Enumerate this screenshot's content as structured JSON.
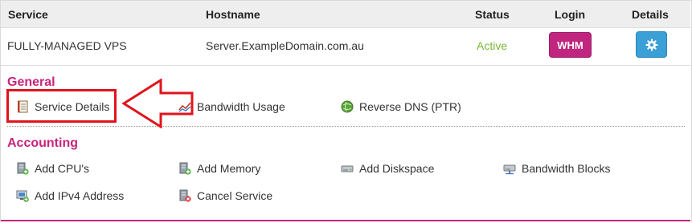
{
  "table": {
    "headers": {
      "service": "Service",
      "hostname": "Hostname",
      "status": "Status",
      "login": "Login",
      "details": "Details"
    },
    "row": {
      "service": "FULLY-MANAGED VPS",
      "hostname": "Server.ExampleDomain.com.au",
      "status": "Active",
      "login_button": "WHM",
      "details_icon": "gear-icon"
    }
  },
  "general": {
    "title": "General",
    "links": [
      {
        "label": "Service Details",
        "icon": "notebook-icon"
      },
      {
        "label": "Bandwidth Usage",
        "icon": "graph-icon"
      },
      {
        "label": "Reverse DNS (PTR)",
        "icon": "globe-icon"
      }
    ]
  },
  "accounting": {
    "title": "Accounting",
    "links": [
      {
        "label": "Add CPU's",
        "icon": "server-add-icon"
      },
      {
        "label": "Add Memory",
        "icon": "server-add-icon"
      },
      {
        "label": "Add Diskspace",
        "icon": "drive-icon"
      },
      {
        "label": "Bandwidth Blocks",
        "icon": "network-drive-icon"
      },
      {
        "label": "Add IPv4 Address",
        "icon": "monitor-add-icon"
      },
      {
        "label": "Cancel Service",
        "icon": "server-delete-icon"
      }
    ]
  },
  "colors": {
    "accent": "#c7247b",
    "active": "#77b833",
    "whm": "#c0267f",
    "details_button": "#3aa0d6",
    "annotation": "#e0141c"
  }
}
